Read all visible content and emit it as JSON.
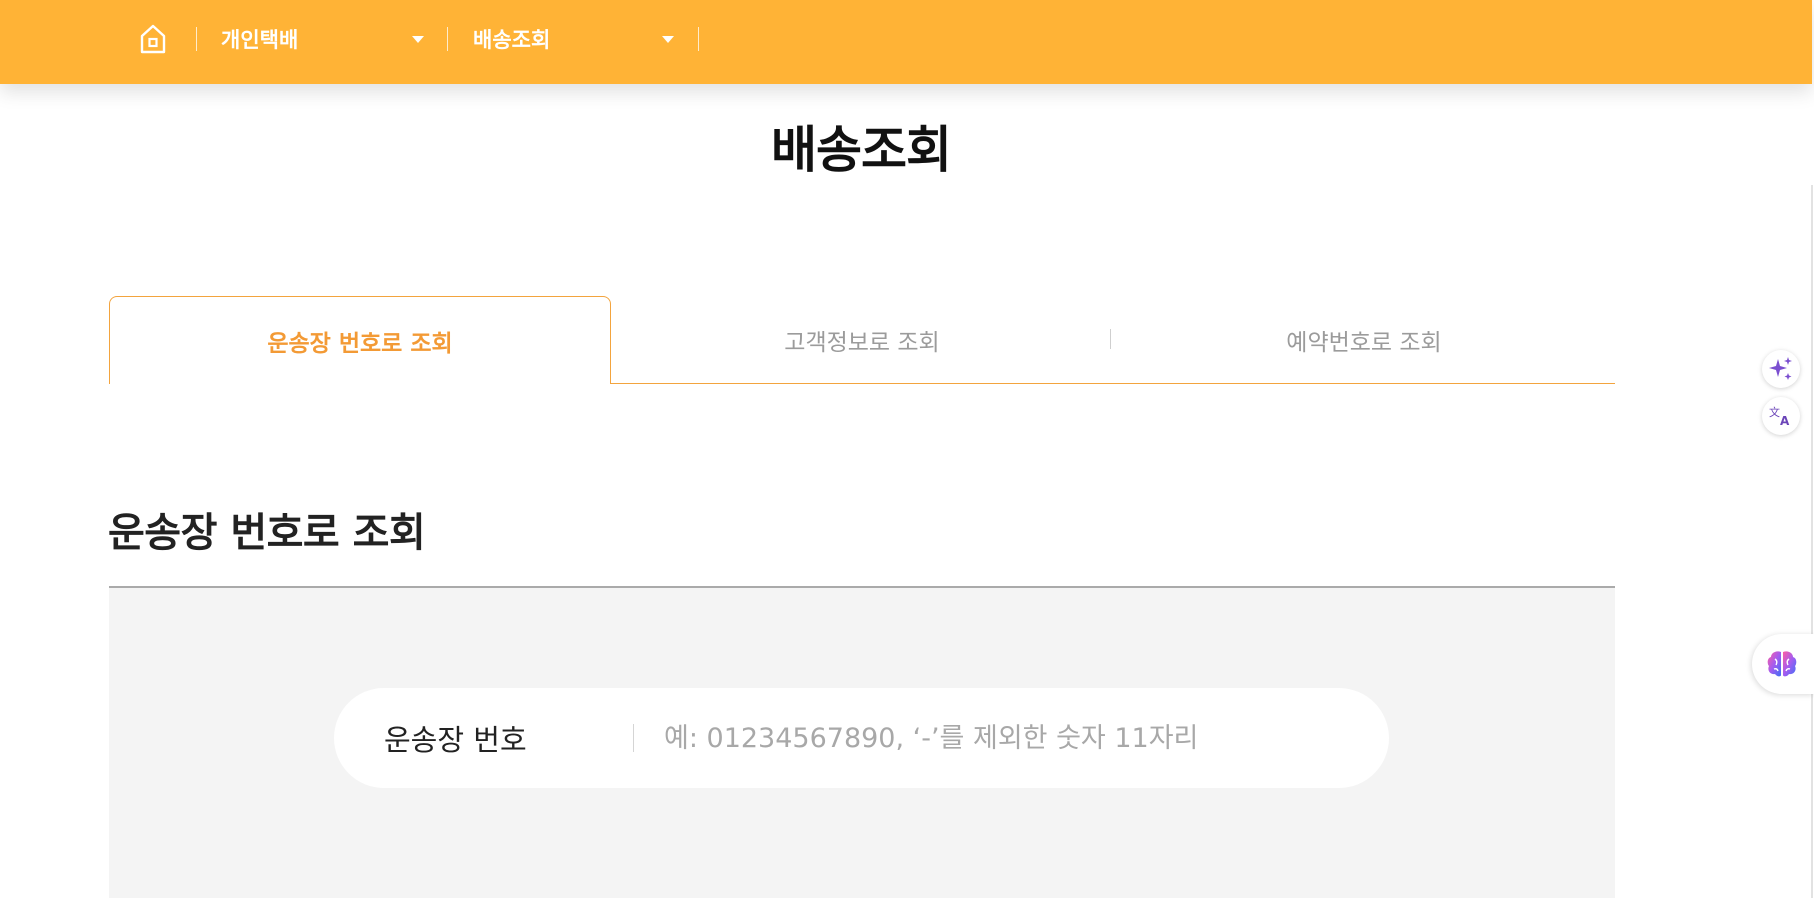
{
  "header": {
    "home_icon": "home-icon",
    "menu1": {
      "label": "개인택배"
    },
    "menu2": {
      "label": "배송조회"
    },
    "accent_color": "#ffb336"
  },
  "page_title": "배송조회",
  "tabs": [
    {
      "label": "운송장 번호로 조회",
      "active": true
    },
    {
      "label": "고객정보로 조회",
      "active": false
    },
    {
      "label": "예약번호로 조회",
      "active": false
    }
  ],
  "section": {
    "heading": "운송장 번호로 조회",
    "field_label": "운송장 번호",
    "input_placeholder": "예: 01234567890, ‘-’를 제외한 숫자 11자리",
    "input_value": ""
  },
  "side_buttons": {
    "sparkle_icon": "sparkle-icon",
    "translate_icon": "translate-icon",
    "brain_icon": "brain-icon"
  },
  "colors": {
    "active_tab": "#f39a35",
    "inactive_tab": "#9b9b9b",
    "panel_bg": "#f4f4f4"
  }
}
